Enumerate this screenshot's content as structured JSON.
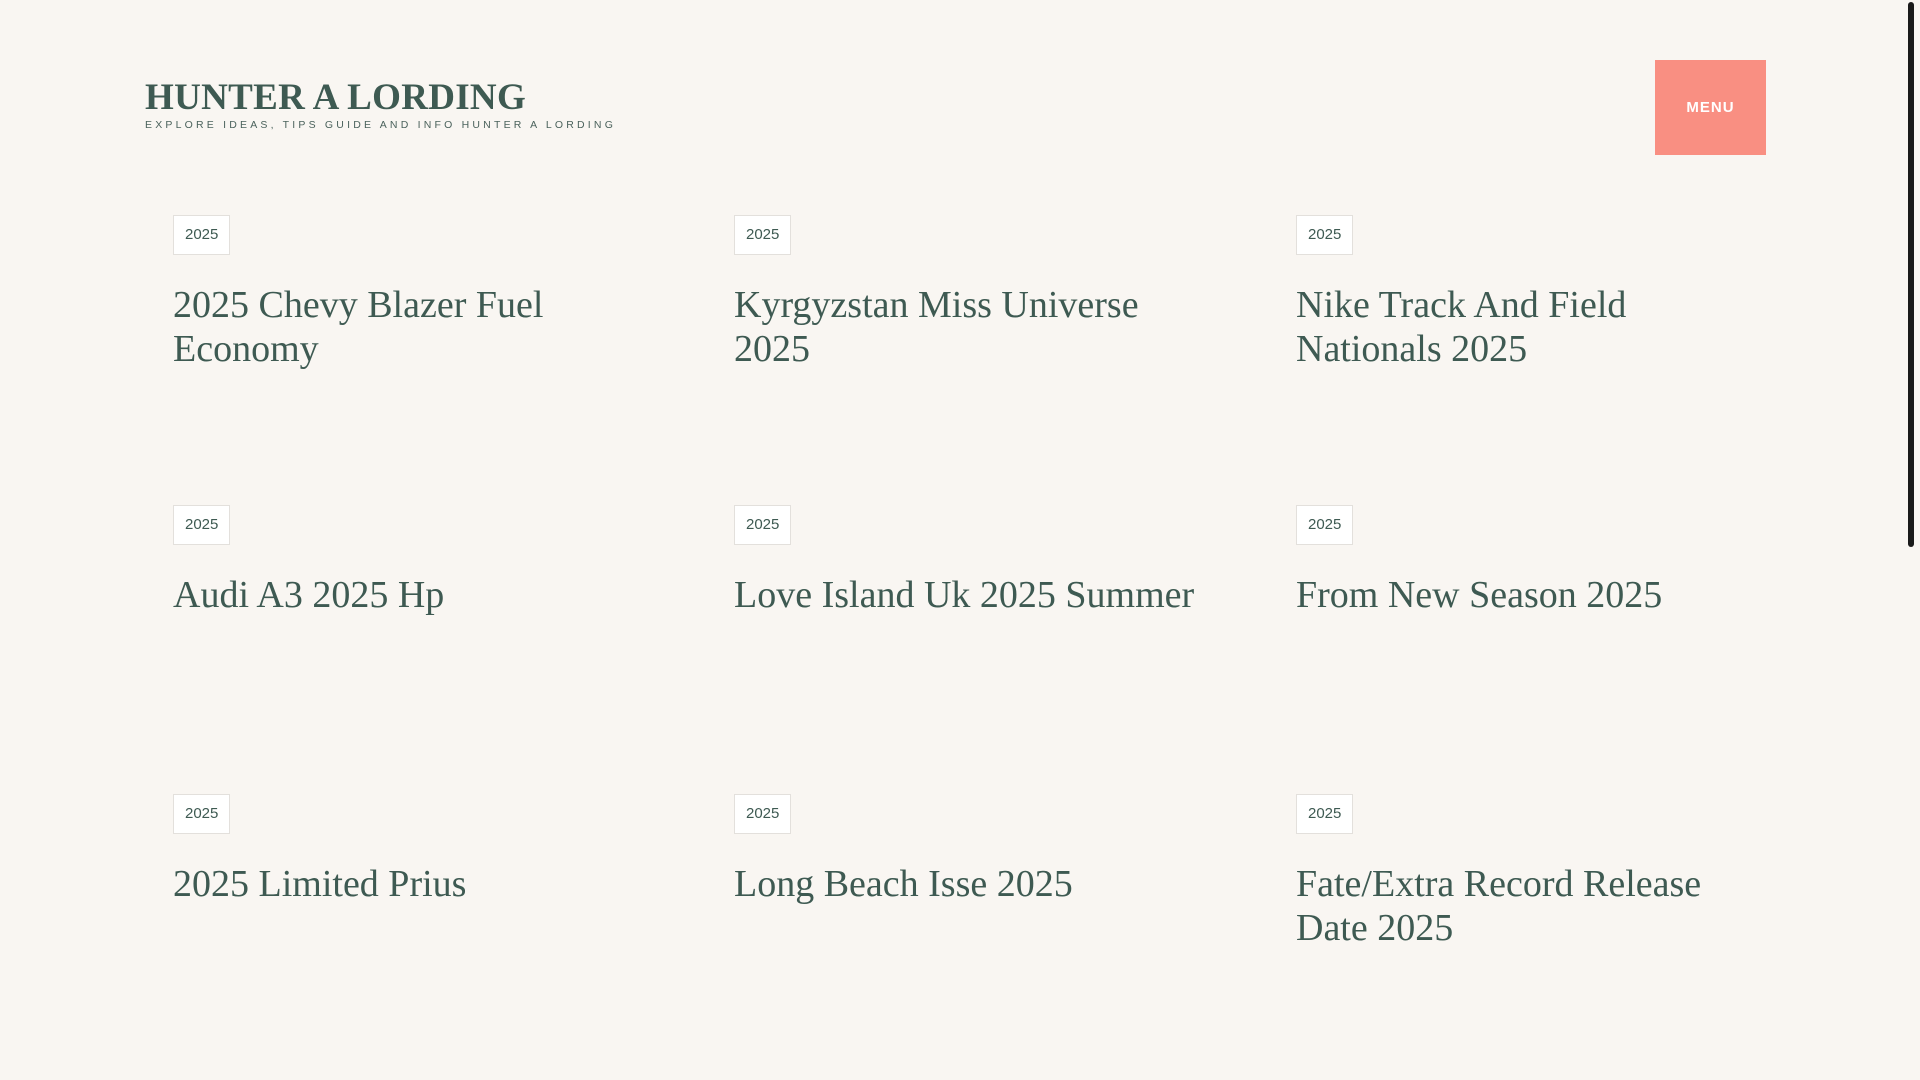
{
  "site": {
    "title": "HUNTER A LORDING",
    "description": "EXPLORE IDEAS, TIPS GUIDE AND INFO HUNTER A LORDING"
  },
  "header": {
    "menu_label": "MENU"
  },
  "posts": [
    {
      "tag": "2025",
      "title": "2025 Chevy Blazer Fuel Economy"
    },
    {
      "tag": "2025",
      "title": "Kyrgyzstan Miss Universe 2025"
    },
    {
      "tag": "2025",
      "title": "Nike Track And Field Nationals 2025"
    },
    {
      "tag": "2025",
      "title": "Audi A3 2025 Hp"
    },
    {
      "tag": "2025",
      "title": "Love Island Uk 2025 Summer"
    },
    {
      "tag": "2025",
      "title": "From New Season 2025"
    },
    {
      "tag": "2025",
      "title": "2025 Limited Prius"
    },
    {
      "tag": "2025",
      "title": "Long Beach Isse 2025"
    },
    {
      "tag": "2025",
      "title": "Fate/Extra Record Release Date 2025"
    }
  ],
  "colors": {
    "background": "#f9f6f2",
    "text": "#3e5a52",
    "accent": "#f98f82"
  }
}
